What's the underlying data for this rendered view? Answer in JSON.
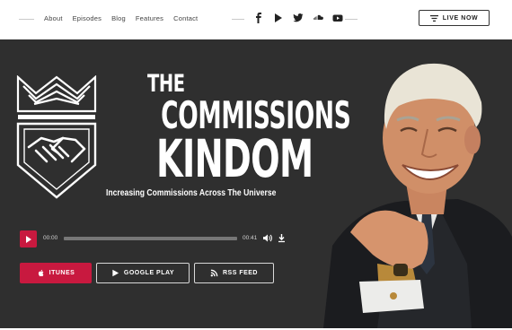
{
  "nav": {
    "items": [
      "About",
      "Episodes",
      "Blog",
      "Features",
      "Contact"
    ]
  },
  "social": {
    "icons": [
      "facebook-icon",
      "google-play-icon",
      "twitter-icon",
      "soundcloud-icon",
      "youtube-icon"
    ]
  },
  "header": {
    "live_label": "LIVE NOW"
  },
  "hero": {
    "title_line1": "THE",
    "title_line2": "COMMISSIONS",
    "title_line3": "KINDOM",
    "tagline": "Increasing Commissions Across The Universe"
  },
  "player": {
    "current_time": "00:00",
    "duration": "00:41",
    "progress": 0
  },
  "buttons": {
    "itunes": "ITUNES",
    "google_play": "GOOGLE PLAY",
    "rss": "RSS FEED"
  },
  "colors": {
    "accent": "#c8193f",
    "hero_bg": "#2f2f2f"
  }
}
